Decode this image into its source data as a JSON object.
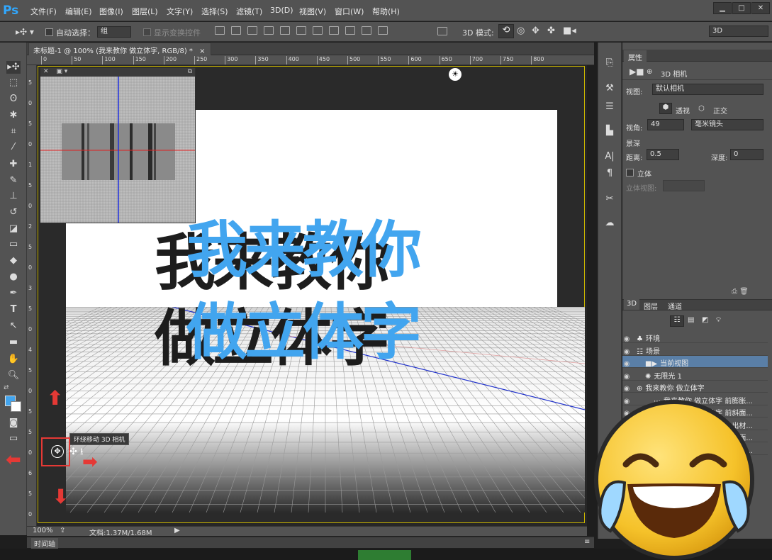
{
  "app": {
    "logo": "Ps"
  },
  "menu": [
    "文件(F)",
    "编辑(E)",
    "图像(I)",
    "图层(L)",
    "文字(Y)",
    "选择(S)",
    "滤镜(T)",
    "3D(D)",
    "视图(V)",
    "窗口(W)",
    "帮助(H)"
  ],
  "window_controls": {
    "minimize": "▁",
    "maximize": "□",
    "close": "✕"
  },
  "options": {
    "auto_select_label": "自动选择：",
    "auto_select_value": "组",
    "show_transform_label": "显示变换控件",
    "mode_3d_label": "3D 模式:",
    "workspace_value": "3D"
  },
  "document": {
    "tab_title": "未标题-1 @ 100% (我来教你 做立体字, RGB/8) *",
    "tab_close": "×",
    "zoom": "100%",
    "doc_size": "文档:1.37M/1.68M",
    "text_line1": "我来教你",
    "text_line2": "做立体字"
  },
  "ruler": {
    "h_ticks": [
      "0",
      "50",
      "100",
      "150",
      "200",
      "250",
      "300",
      "350",
      "400",
      "450",
      "500",
      "550",
      "600",
      "650",
      "700",
      "750",
      "800"
    ],
    "v_ticks": [
      "5",
      "0",
      "5",
      "0",
      "1",
      "5",
      "0",
      "2",
      "5",
      "0",
      "3",
      "5",
      "0",
      "4",
      "5",
      "0",
      "5",
      "5",
      "0",
      "6",
      "5",
      "0"
    ]
  },
  "tooltip": "环绕移动 3D 相机",
  "timeline_label": "时间轴",
  "properties": {
    "tab": "属性",
    "camera_label": "3D 相机",
    "view_label": "视图:",
    "view_value": "默认相机",
    "perspective": "透视",
    "orthographic": "正交",
    "fov_label": "视角:",
    "fov_value": "49",
    "lens_value": "毫米镜头",
    "dof_label": "景深",
    "distance_label": "距离:",
    "distance_value": "0.5",
    "depth_label": "深度:",
    "depth_value": "0",
    "stereo_label": "立体",
    "stereo_view_label": "立体视图:"
  },
  "panel3d": {
    "tabs": [
      "3D",
      "图层",
      "通道"
    ],
    "rows": [
      {
        "label": "环境",
        "indent": 0
      },
      {
        "label": "场景",
        "indent": 0
      },
      {
        "label": "当前视图",
        "indent": 1,
        "selected": true
      },
      {
        "label": "无限光 1",
        "indent": 1
      },
      {
        "label": "我来教你 做立体字",
        "indent": 0
      },
      {
        "label": "我来教你 做立体字 前膨胀...",
        "indent": 2
      },
      {
        "label": "我来教你 做立体字 前斜面...",
        "indent": 2
      },
      {
        "label": "我来教你 做立体字 凸出材...",
        "indent": 2
      },
      {
        "label": "我来教你 做立体字 后斜面...",
        "indent": 2
      },
      {
        "label": "我来教你 做立体字 后膨胀...",
        "indent": 2
      }
    ]
  },
  "colors": {
    "accent_blue": "#42a5ef",
    "selection": "#5a7fa7",
    "canvas_border": "#c8b400",
    "arrow_red": "#e53935"
  }
}
